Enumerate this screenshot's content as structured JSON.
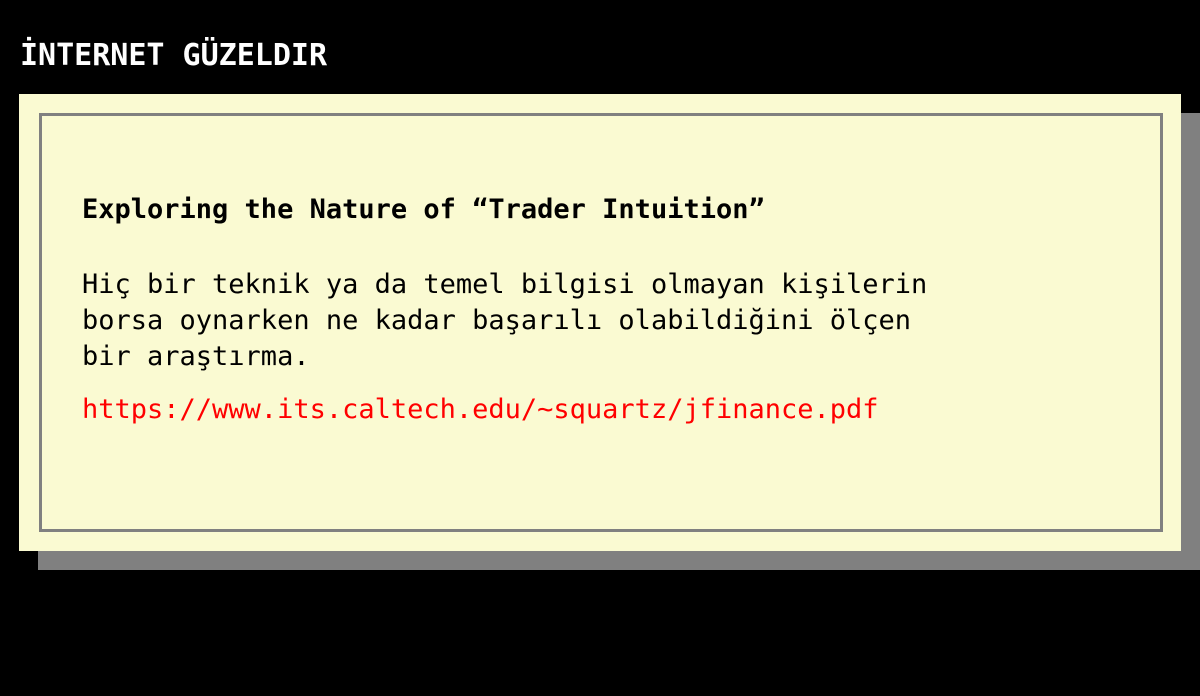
{
  "header": {
    "title": "İNTERNET GÜZELDIR"
  },
  "article": {
    "title": "Exploring the Nature of “Trader Intuition”",
    "description": "Hiç bir teknik ya da temel bilgisi olmayan kişilerin\nborsa oynarken ne kadar başarılı olabildiğini ölçen\nbir araştırma.",
    "link": "https://www.its.caltech.edu/~squartz/jfinance.pdf"
  },
  "colors": {
    "background": "#000000",
    "card": "#fafad2",
    "border": "#808080",
    "link": "#ff0000"
  }
}
